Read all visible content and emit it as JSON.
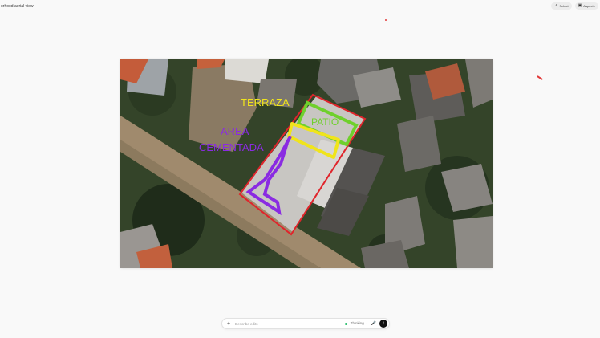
{
  "window": {
    "title": "orhood aerial view"
  },
  "toolbar": {
    "select_label": "Select",
    "select_icon": "cursor-icon",
    "aspect_label": "Aspect r",
    "aspect_icon": "aspect-ratio-icon"
  },
  "image": {
    "labels": {
      "terraza": "TERRAZA",
      "patio": "PATIO",
      "area_line1": "AREA",
      "area_line2": "CEMENTADA"
    },
    "colors": {
      "outline": "#e0242b",
      "terraza": "#f0e41c",
      "patio": "#6fd02c",
      "cementada": "#8a2be2"
    }
  },
  "prompt": {
    "placeholder": "Describe edits",
    "model_label": "Thinking",
    "add_icon": "plus-icon",
    "mic_icon": "mic-icon",
    "send_icon": "arrow-up-icon"
  }
}
